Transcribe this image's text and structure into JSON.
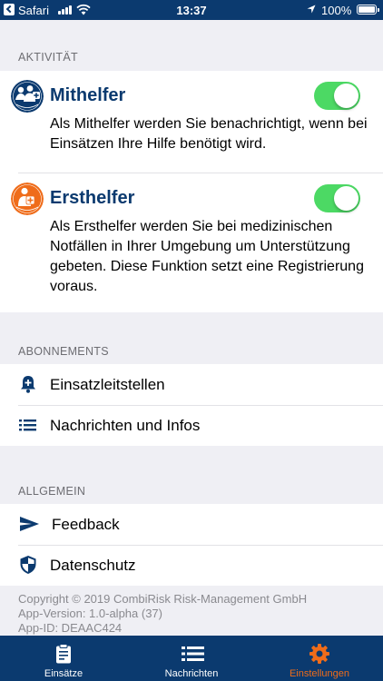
{
  "statusbar": {
    "carrier": "Safari",
    "time": "13:37",
    "battery": "100%"
  },
  "colors": {
    "brand_blue": "#0b3a6f",
    "accent_orange": "#ef6c1a",
    "toggle_on": "#4cd964"
  },
  "activity": {
    "header": "AKTIVITÄT",
    "mithelfer": {
      "title": "Mithelfer",
      "description": "Als Mithelfer werden Sie benachrichtigt, wenn bei Einsätzen Ihre Hilfe benötigt wird.",
      "enabled": true,
      "icon": "mithelfer-logo-icon"
    },
    "ersthelfer": {
      "title": "Ersthelfer",
      "description": "Als Ersthelfer werden Sie bei medizinischen Notfällen in Ihrer Umgebung um Unterstützung gebeten. Diese Funktion setzt eine Registrierung voraus.",
      "enabled": true,
      "icon": "ersthelfer-logo-icon"
    }
  },
  "subscriptions": {
    "header": "ABONNEMENTS",
    "items": [
      {
        "label": "Einsatzleitstellen",
        "icon": "bell-plus-icon"
      },
      {
        "label": "Nachrichten und Infos",
        "icon": "list-icon"
      }
    ]
  },
  "general": {
    "header": "ALLGEMEIN",
    "items": [
      {
        "label": "Feedback",
        "icon": "send-icon"
      },
      {
        "label": "Datenschutz",
        "icon": "shield-icon"
      }
    ]
  },
  "footer": {
    "copyright": "Copyright © 2019 CombiRisk Risk-Management GmbH",
    "version": "App-Version: 1.0-alpha (37)",
    "app_id": "App-ID: DEAAC424"
  },
  "tabbar": {
    "tabs": [
      {
        "label": "Einsätze",
        "icon": "clipboard-icon",
        "active": false
      },
      {
        "label": "Nachrichten",
        "icon": "list-icon",
        "active": false
      },
      {
        "label": "Einstellungen",
        "icon": "gear-icon",
        "active": true
      }
    ]
  }
}
